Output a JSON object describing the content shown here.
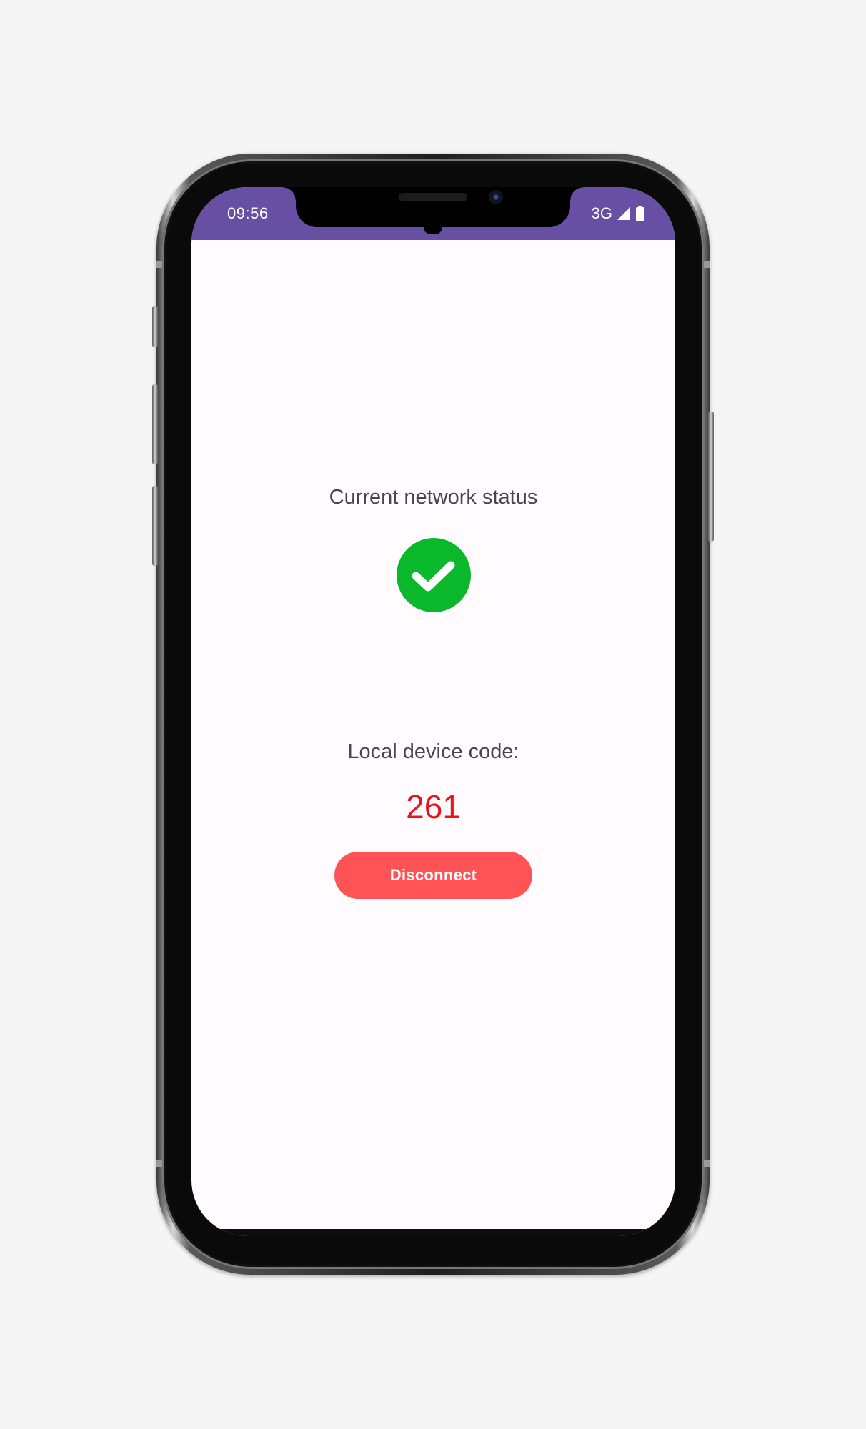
{
  "status_bar": {
    "time": "09:56",
    "network_type": "3G",
    "icons": [
      "signal-icon",
      "battery-icon"
    ]
  },
  "main": {
    "network_status_label": "Current network status",
    "network_status_icon": "check-circle-icon",
    "network_status_color": "#09b92b",
    "device_code_label": "Local device code:",
    "device_code_value": "261",
    "device_code_color": "#e8141b",
    "disconnect_label": "Disconnect",
    "disconnect_color": "#ff5356"
  },
  "colors": {
    "status_bar_bg": "#6750a4",
    "screen_bg": "#fffbfe",
    "page_bg": "#f4f5f4"
  }
}
